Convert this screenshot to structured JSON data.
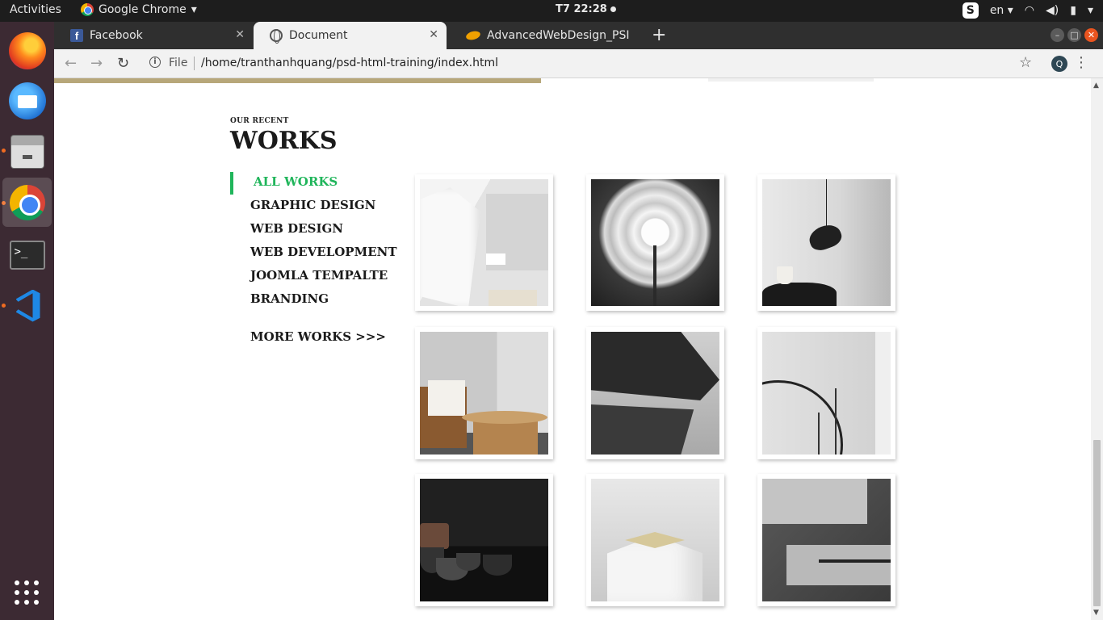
{
  "system": {
    "activities": "Activities",
    "app_menu": "Google Chrome",
    "clock": "T7 22:28",
    "lang": "en"
  },
  "browser": {
    "tabs": [
      {
        "label": "Facebook"
      },
      {
        "label": "Document"
      },
      {
        "label": "AdvancedWebDesign_PSI"
      }
    ],
    "scheme_label": "File",
    "url": "/home/tranthanhquang/psd-html-training/index.html",
    "profile_initial": "Q"
  },
  "page": {
    "section_sub": "OUR RECENT",
    "section_title": "WORKS",
    "filters": [
      {
        "label": "ALL WORKS",
        "active": true
      },
      {
        "label": "GRAPHIC DESIGN",
        "active": false
      },
      {
        "label": "WEB DESIGN",
        "active": false
      },
      {
        "label": "WEB DEVELOPMENT",
        "active": false
      },
      {
        "label": "JOOMLA TEMPALTE",
        "active": false
      },
      {
        "label": "BRANDING",
        "active": false
      }
    ],
    "more_works": "MORE WORKS >>>",
    "accent_color": "#20b55b"
  }
}
